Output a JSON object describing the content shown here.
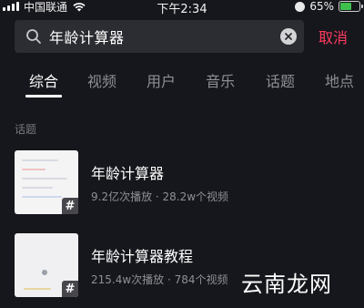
{
  "status_bar": {
    "carrier": "中国联通",
    "time": "下午2:34",
    "battery": "65%",
    "battery_color": "#3fc04d"
  },
  "search": {
    "query": "年龄计算器",
    "cancel_label": "取消",
    "accent_color": "#ff3a5f"
  },
  "tabs": [
    {
      "label": "综合",
      "active": true
    },
    {
      "label": "视频",
      "active": false
    },
    {
      "label": "用户",
      "active": false
    },
    {
      "label": "音乐",
      "active": false
    },
    {
      "label": "话题",
      "active": false
    },
    {
      "label": "地点",
      "active": false
    }
  ],
  "section": {
    "title": "话题"
  },
  "results": [
    {
      "title": "年龄计算器",
      "meta": "9.2亿次播放 · 28.2w个视频",
      "badge": "#"
    },
    {
      "title": "年龄计算器教程",
      "meta": "215.4w次播放 · 784个视频",
      "badge": "#"
    }
  ],
  "watermark": "云南龙网"
}
